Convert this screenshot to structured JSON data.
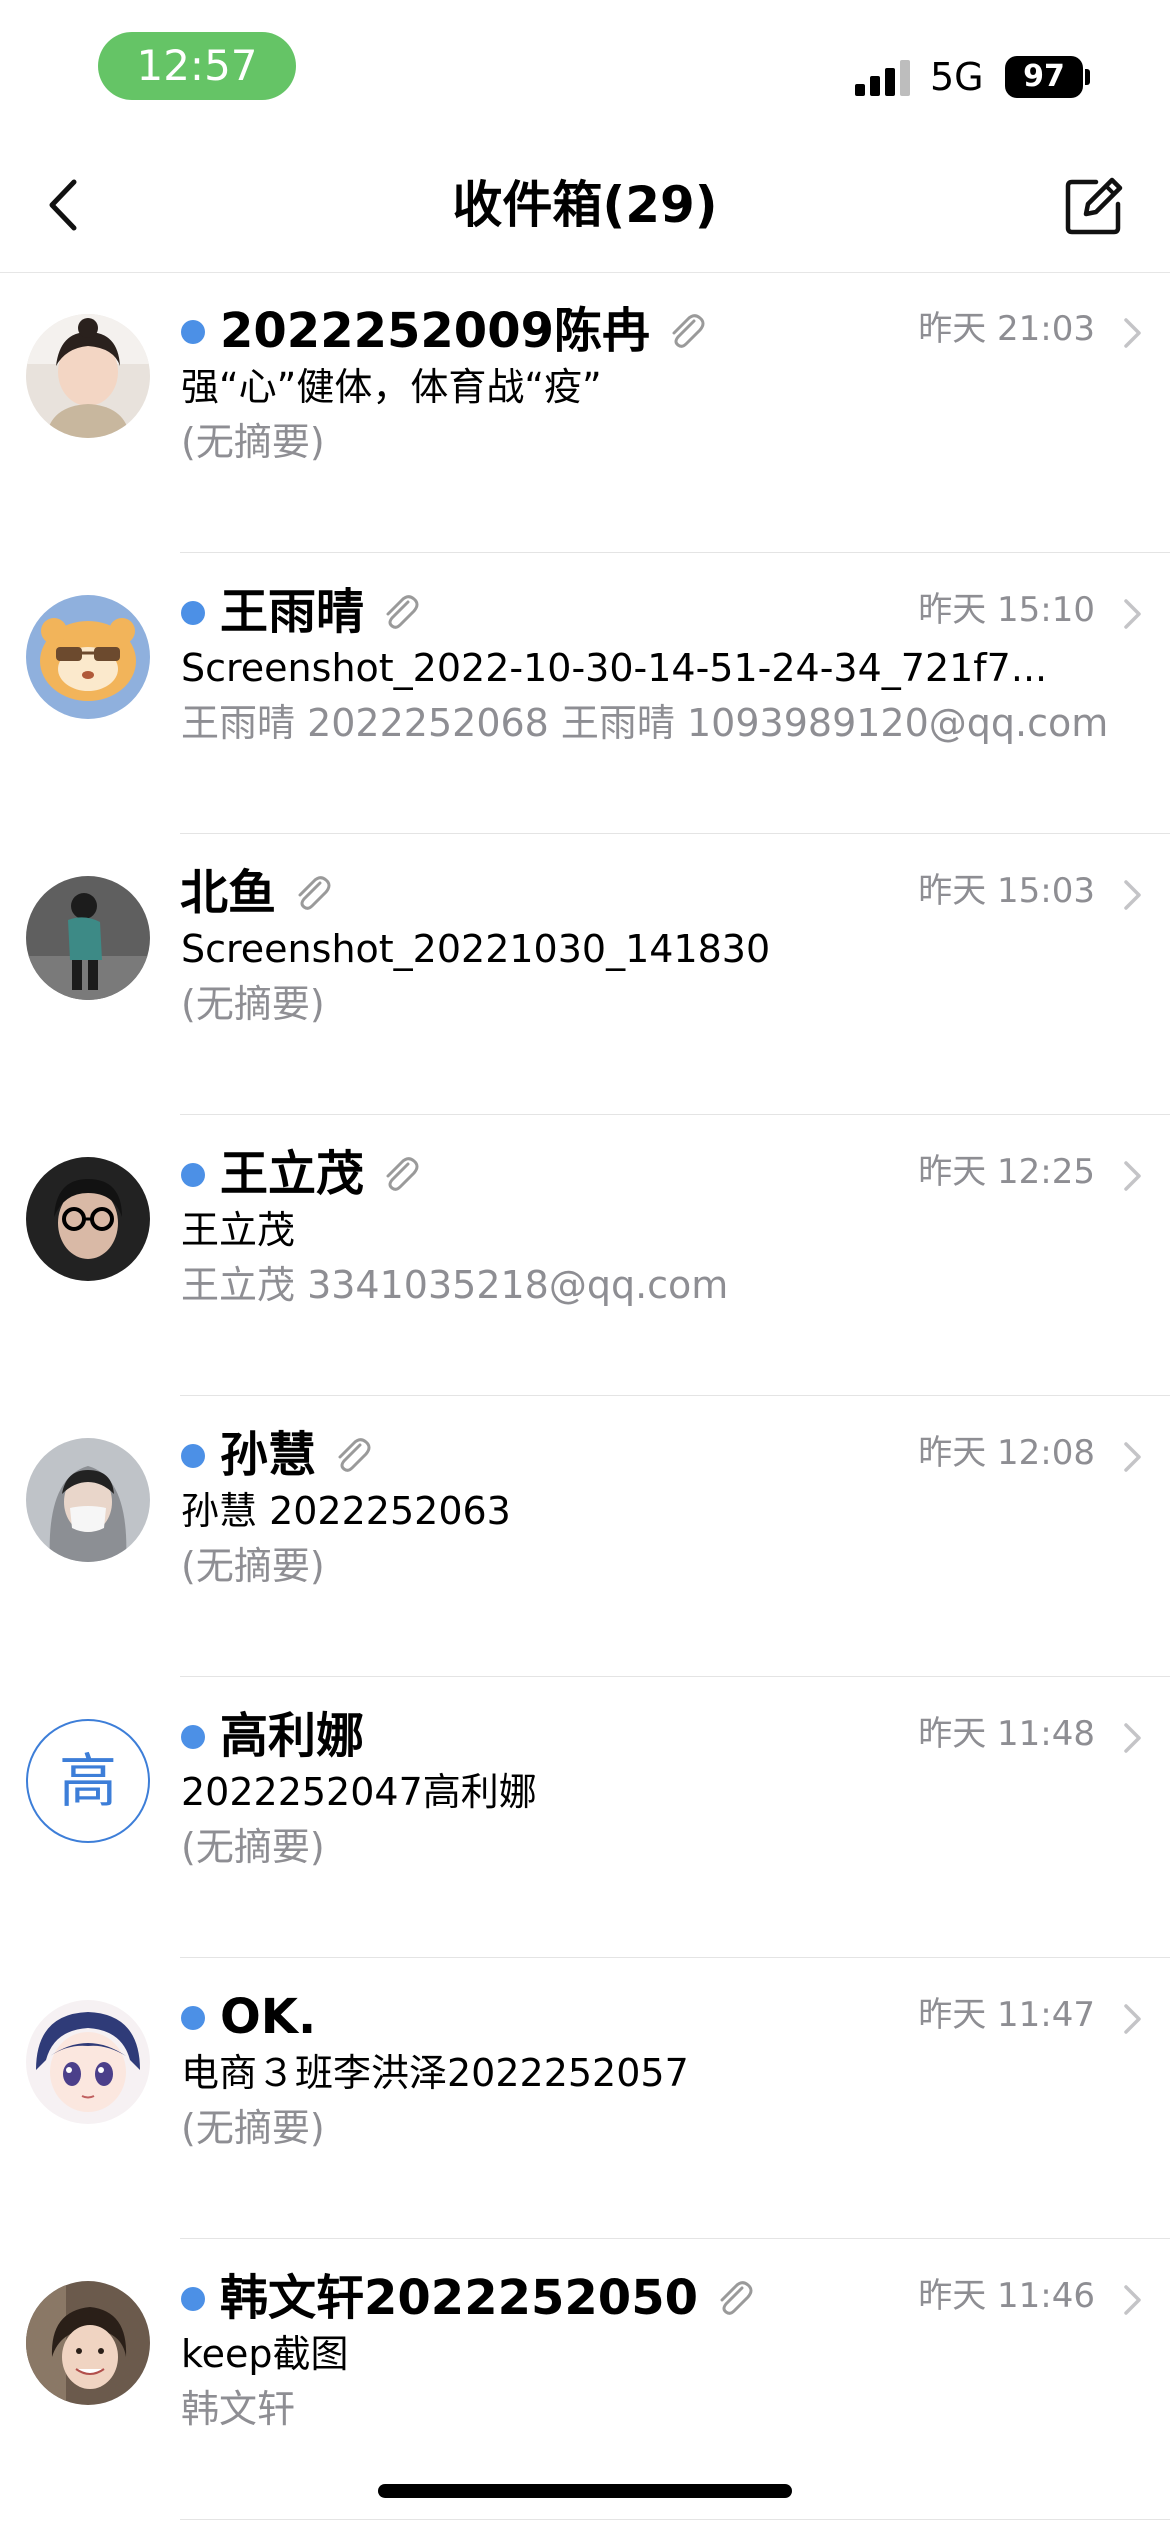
{
  "status_bar": {
    "time": "12:57",
    "network": "5G",
    "battery": "97"
  },
  "nav": {
    "title": "收件箱(29)",
    "back_icon": "chevron-left-icon",
    "compose_icon": "compose-icon"
  },
  "emails": [
    {
      "sender": "2022252009陈冉",
      "unread": true,
      "attachment": true,
      "time": "昨天 21:03",
      "subject": "强“心”健体，体育战“疫”",
      "preview": "(无摘要)",
      "avatar": "photo"
    },
    {
      "sender": "王雨晴",
      "unread": true,
      "attachment": true,
      "time": "昨天 15:10",
      "subject": "Screenshot_2022-10-30-14-51-24-34_721f7...",
      "preview": "王雨晴 2022252068   王雨晴 1093989120@qq.com",
      "avatar": "hamster"
    },
    {
      "sender": "北鱼",
      "unread": false,
      "attachment": true,
      "time": "昨天 15:03",
      "subject": "Screenshot_20221030_141830",
      "preview": "(无摘要)",
      "avatar": "photo"
    },
    {
      "sender": "王立茂",
      "unread": true,
      "attachment": true,
      "time": "昨天 12:25",
      "subject": "王立茂",
      "preview": "王立茂 3341035218@qq.com",
      "avatar": "photo"
    },
    {
      "sender": " 孙慧",
      "unread": true,
      "attachment": true,
      "time": "昨天 12:08",
      "subject": "孙慧  2022252063",
      "preview": "(无摘要)",
      "avatar": "photo"
    },
    {
      "sender": "高利娜",
      "unread": true,
      "attachment": false,
      "time": "昨天 11:48",
      "subject": "2022252047高利娜",
      "preview": "(无摘要)",
      "avatar": "letter",
      "avatar_letter": "高"
    },
    {
      "sender": "OK.",
      "unread": true,
      "attachment": false,
      "time": "昨天 11:47",
      "subject": "电商３班李洪泽2022252057",
      "preview": "(无摘要)",
      "avatar": "anime"
    },
    {
      "sender": "韩文轩2022252050",
      "unread": true,
      "attachment": true,
      "time": "昨天 11:46",
      "subject": "keep截图",
      "preview": "韩文轩",
      "avatar": "photo"
    }
  ]
}
